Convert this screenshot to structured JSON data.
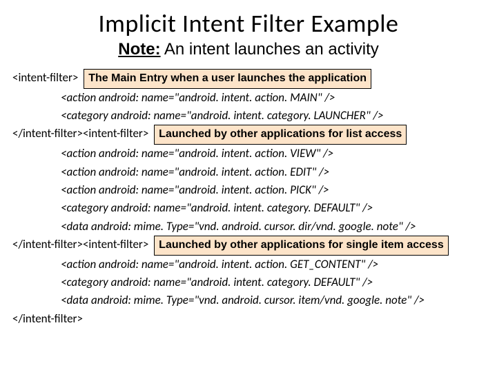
{
  "title": "Implicit Intent Filter Example",
  "subtitle": {
    "note_label": "Note:",
    "rest": " An intent launches an activity"
  },
  "code": {
    "l1a": "<intent-filter>",
    "c1": "The Main Entry when a user launches the application",
    "l2": "<action android: name=\"android. intent. action. MAIN\" />",
    "l3": "<category android: name=\"android. intent. category. LAUNCHER\" />",
    "l4": "</intent-filter><intent-filter>",
    "c2": "Launched by other applications for list access",
    "l5": "<action android: name=\"android. intent. action. VIEW\" />",
    "l6": "<action android: name=\"android. intent. action. EDIT\" />",
    "l7": "<action android: name=\"android. intent. action. PICK\" />",
    "l8": "<category android: name=\"android. intent. category. DEFAULT\" />",
    "l9": "<data android: mime. Type=\"vnd. android. cursor. dir/vnd. google. note\" />",
    "l10": "</intent-filter><intent-filter>",
    "c3": "Launched by other applications for single item access",
    "l11": "<action android: name=\"android. intent. action. GET_CONTENT\" />",
    "l12": "<category android: name=\"android. intent. category. DEFAULT\" />",
    "l13": "<data android: mime. Type=\"vnd. android. cursor. item/vnd. google. note\" />",
    "l14": "</intent-filter>"
  }
}
